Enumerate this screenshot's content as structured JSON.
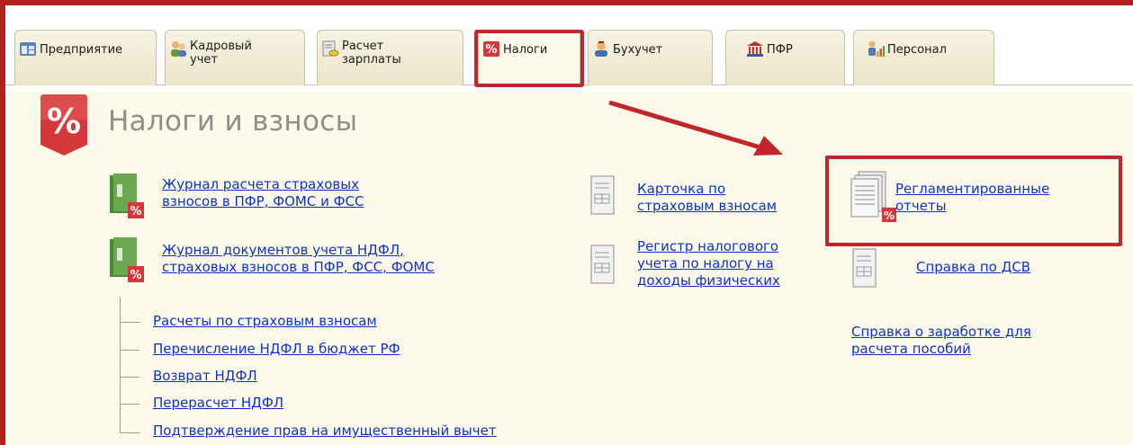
{
  "tabs": [
    {
      "label": "Предприятие",
      "icon": "enterprise-icon",
      "active": false
    },
    {
      "label": "Кадровый\nучет",
      "icon": "personnel-accounting-icon",
      "active": false
    },
    {
      "label": "Расчет\nзарплаты",
      "icon": "payroll-icon",
      "active": false
    },
    {
      "label": "Налоги",
      "icon": "percent-tax-icon",
      "active": true
    },
    {
      "label": "Бухучет",
      "icon": "accounting-person-icon",
      "active": false
    },
    {
      "label": "ПФР",
      "icon": "pension-fund-icon",
      "active": false
    },
    {
      "label": "Персонал",
      "icon": "staff-chart-icon",
      "active": false
    }
  ],
  "section": {
    "title": "Налоги и взносы",
    "icon": "percent-big-icon"
  },
  "journals": [
    {
      "text": "Журнал расчета страховых\nвзносов в ПФР, ФОМС и ФСС",
      "icon": "journal-book-percent-icon"
    },
    {
      "text": "Журнал документов учета НДФЛ,\nстраховых взносов в ПФР, ФСС, ФОМС",
      "icon": "journal-book-percent-icon"
    }
  ],
  "subitems": [
    "Расчеты по страховым взносам",
    "Перечисление НДФЛ в бюджет РФ",
    "Возврат НДФЛ",
    "Перерасчет НДФЛ",
    "Подтверждение прав на имущественный вычет"
  ],
  "middle": [
    {
      "text": "Карточка по\nстраховым взносам",
      "icon": "report-sheet-icon"
    },
    {
      "text": "Регистр налогового\nучета по налогу на\nдоходы физических",
      "icon": "report-sheet-icon"
    }
  ],
  "right": [
    {
      "text": "Регламентированные\nотчеты",
      "icon": "regulated-reports-icon",
      "highlighted": true
    },
    {
      "text": "Справка по ДСВ",
      "icon": "report-sheet-icon"
    },
    {
      "text": "Справка о заработке для\nрасчета пособий",
      "icon": ""
    }
  ],
  "colors": {
    "highlight": "#c0262a",
    "link": "#0b33c9",
    "background": "#fdfaec"
  }
}
